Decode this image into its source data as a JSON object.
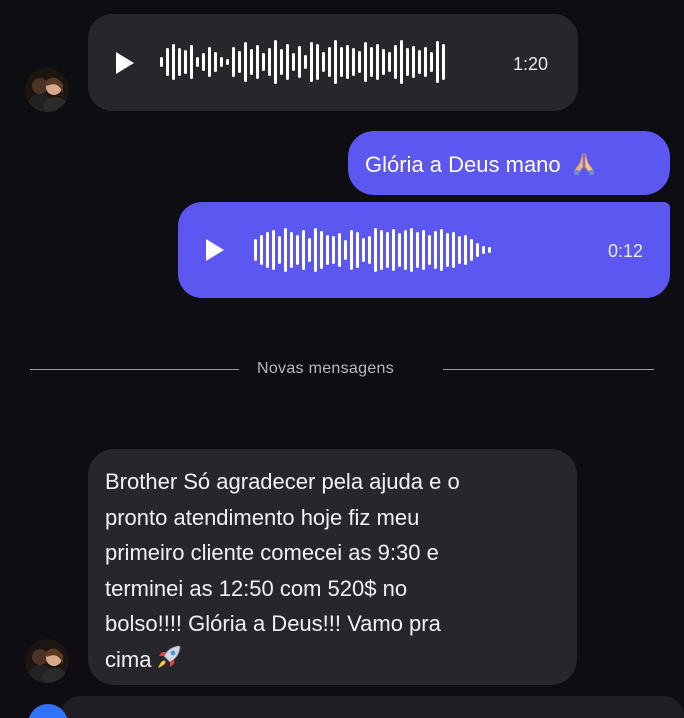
{
  "conversation": {
    "messages": [
      {
        "id": "m1",
        "direction": "incoming",
        "type": "voice",
        "duration": "1:20",
        "waveform": [
          10,
          28,
          36,
          28,
          24,
          34,
          10,
          18,
          30,
          20,
          10,
          6,
          30,
          22,
          40,
          26,
          34,
          18,
          28,
          44,
          26,
          36,
          18,
          32,
          14,
          40,
          36,
          20,
          30,
          44,
          30,
          34,
          28,
          22,
          40,
          30,
          36,
          26,
          20,
          34,
          44,
          28,
          32,
          24,
          30,
          20,
          42,
          36
        ]
      },
      {
        "id": "m2",
        "direction": "outgoing",
        "type": "text",
        "text": "Glória a Deus mano",
        "emoji": "pray"
      },
      {
        "id": "m3",
        "direction": "outgoing",
        "type": "voice",
        "duration": "0:12",
        "waveform": [
          22,
          30,
          36,
          40,
          28,
          44,
          36,
          30,
          40,
          24,
          44,
          38,
          30,
          28,
          34,
          20,
          40,
          36,
          24,
          28,
          44,
          40,
          36,
          42,
          34,
          40,
          44,
          36,
          40,
          30,
          38,
          42,
          34,
          36,
          28,
          30,
          22,
          14,
          8,
          6
        ]
      },
      {
        "id": "m4",
        "direction": "incoming",
        "type": "text",
        "lines": [
          "Brother Só agradecer pela ajuda e o",
          "pronto atendimento hoje fiz meu",
          "primeiro cliente comecei as 9:30 e",
          "terminei as 12:50 com 520$ no",
          "bolso!!!! Glória a Deus!!! Vamo pra",
          "cima"
        ],
        "emoji": "rocket"
      }
    ],
    "separator_label": "Novas mensagens"
  },
  "colors": {
    "background": "#0d0d12",
    "incoming_bubble": "#26262b",
    "outgoing_bubble": "#5b57f0",
    "separator_line": "#9a9aa4",
    "accent_button": "#2f73ff"
  },
  "icons": {
    "play": "play-icon",
    "avatar": "avatar",
    "pray_emoji": "folded-hands-icon",
    "rocket_emoji": "rocket-icon"
  }
}
